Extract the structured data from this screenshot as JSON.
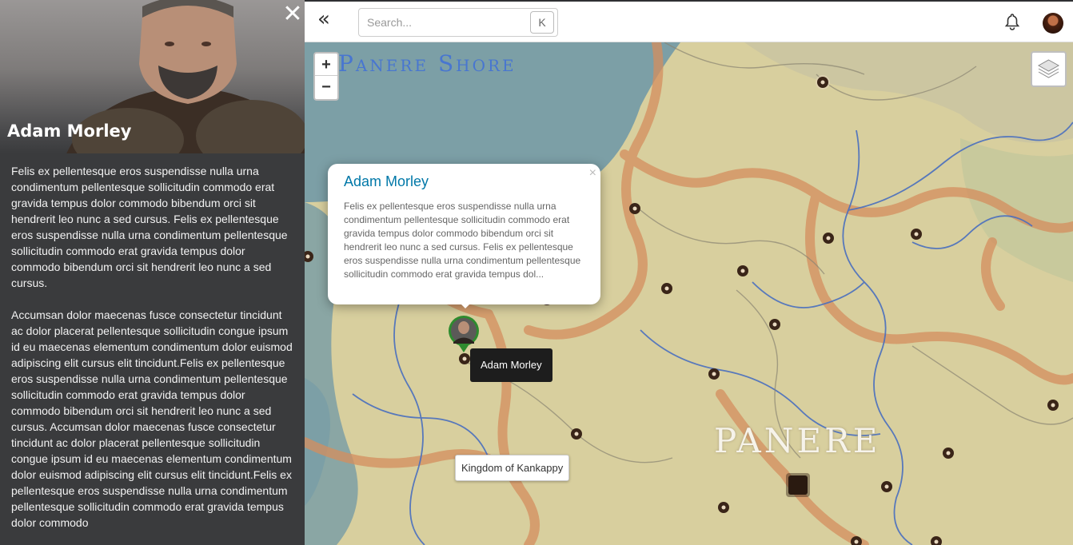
{
  "panel": {
    "title": "Adam Morley",
    "paragraphs": [
      "Felis ex pellentesque eros suspendisse nulla urna condimentum pellentesque sollicitudin commodo erat gravida tempus dolor commodo bibendum orci sit hendrerit leo nunc a sed cursus. Felis ex pellentesque eros suspendisse nulla urna condimentum pellentesque sollicitudin commodo erat gravida tempus dolor commodo bibendum orci sit hendrerit leo nunc a sed cursus.",
      "Accumsan dolor maecenas fusce consectetur tincidunt ac dolor placerat pellentesque sollicitudin congue ipsum id eu maecenas elementum condimentum dolor euismod adipiscing elit cursus elit tincidunt.Felis ex pellentesque eros suspendisse nulla urna condimentum pellentesque sollicitudin commodo erat gravida tempus dolor commodo bibendum orci sit hendrerit leo nunc a sed cursus. Accumsan dolor maecenas fusce consectetur tincidunt ac dolor placerat pellentesque sollicitudin congue ipsum id eu maecenas elementum condimentum dolor euismod adipiscing elit cursus elit tincidunt.Felis ex pellentesque eros suspendisse nulla urna condimentum pellentesque sollicitudin commodo erat gravida tempus dolor commodo"
    ],
    "close_glyph": "✕"
  },
  "topbar": {
    "collapse_glyph": "«",
    "search_placeholder": "Search...",
    "search_shortcut": "K"
  },
  "map": {
    "shore_label": "Panere Shore",
    "region_label": "PANERE",
    "zoom_in": "+",
    "zoom_out": "−",
    "popup": {
      "title": "Adam Morley",
      "body": "Felis ex pellentesque eros suspendisse nulla urna condimentum pellentesque sollicitudin commodo erat gravida tempus dolor commodo bibendum orci sit hendrerit leo nunc a sed cursus. Felis ex pellentesque eros suspendisse nulla urna condimentum pellentesque sollicitudin commodo erat gravida tempus dol...",
      "close_glyph": "×"
    },
    "marker_tooltip": "Adam Morley",
    "kingdom_tooltip": "Kingdom of Kankappy"
  },
  "colors": {
    "panel_bg": "#3a3b3d",
    "water": "#7c9fa6",
    "land": "#d8cf9e",
    "river": "#4a6fbf",
    "border": "#c98a5a",
    "popup_title": "#0078a8",
    "marker_ring": "#2e8b2e"
  },
  "icons": [
    "close-icon",
    "collapse-sidebar-icon",
    "bell-icon",
    "layers-icon",
    "city-icon",
    "capital-icon"
  ]
}
